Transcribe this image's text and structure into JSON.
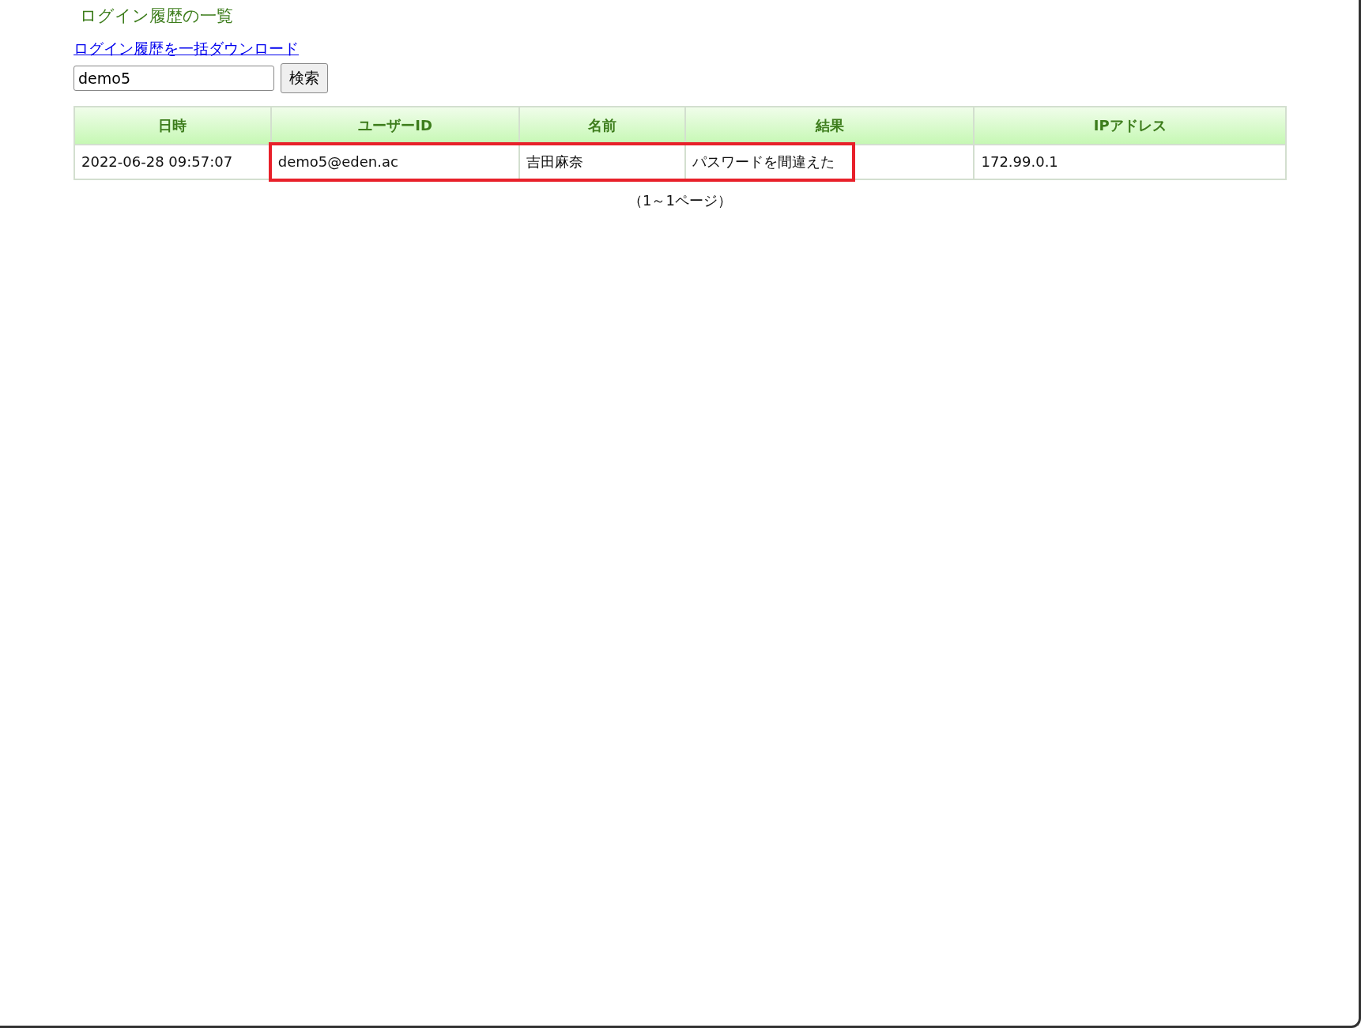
{
  "title": "ログイン履歴の一覧",
  "download_link": "ログイン履歴を一括ダウンロード",
  "search": {
    "value": "demo5",
    "button": "検索"
  },
  "table": {
    "columns": [
      "日時",
      "ユーザーID",
      "名前",
      "結果",
      "IPアドレス"
    ],
    "rows": [
      {
        "cells": [
          {
            "text": "2022-06-28 09:57:07",
            "highlighted": false
          },
          {
            "text": "demo5@eden.ac",
            "highlighted": true
          },
          {
            "text": "吉田麻奈",
            "highlighted": true
          },
          {
            "text": "パスワードを間違えた",
            "highlighted": true
          },
          {
            "text": "172.99.0.1",
            "highlighted": false
          }
        ]
      }
    ]
  },
  "pagination": "（1～1ページ）"
}
